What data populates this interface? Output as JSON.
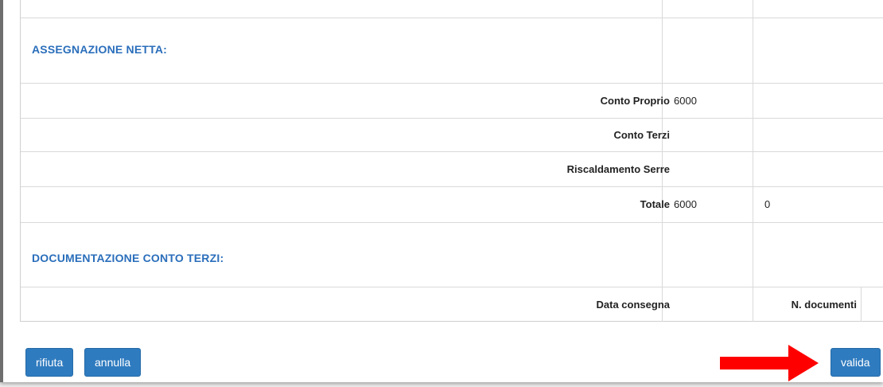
{
  "assegnazione": {
    "section_title": "ASSEGNAZIONE NETTA:",
    "rows": [
      {
        "label": "Conto Proprio",
        "value1": "6000",
        "value2": ""
      },
      {
        "label": "Conto Terzi",
        "value1": "",
        "value2": ""
      },
      {
        "label": "Riscaldamento Serre",
        "value1": "",
        "value2": ""
      },
      {
        "label": "Totale",
        "value1": "6000",
        "value2": "0"
      }
    ]
  },
  "documentazione": {
    "section_title": "DOCUMENTAZIONE CONTO TERZI:",
    "data_consegna_label": "Data consegna",
    "n_documenti_label": "N. documenti"
  },
  "buttons": {
    "rifiuta": "rifiuta",
    "annulla": "annulla",
    "valida": "valida"
  },
  "annotation": {
    "arrow_color": "#ff0000",
    "arrow_icon": "arrow-right-icon"
  }
}
